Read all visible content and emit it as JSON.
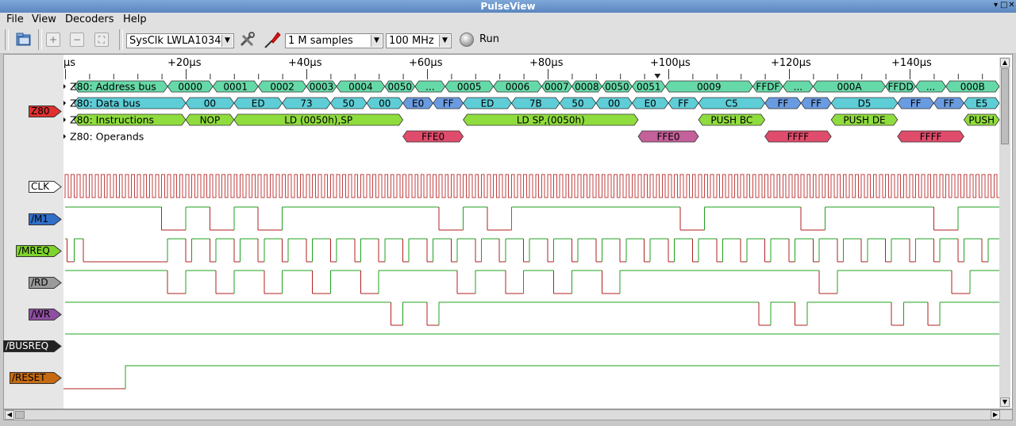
{
  "window": {
    "title": "PulseView"
  },
  "menu": [
    {
      "label": "File",
      "key": "F"
    },
    {
      "label": "View",
      "key": "V"
    },
    {
      "label": "Decoders",
      "key": "D"
    },
    {
      "label": "Help",
      "key": "H"
    }
  ],
  "toolbar": {
    "device": "SysClk LWLA1034",
    "samples": "1 M samples",
    "samplerate": "100 MHz",
    "run_label": "Run",
    "icons": [
      "open-icon",
      "zoom-in-icon",
      "zoom-out-icon",
      "zoom-fit-icon",
      "configure-device-icon",
      "probes-icon"
    ]
  },
  "ruler": {
    "labels": [
      "µs",
      "+20µs",
      "+40µs",
      "+60µs",
      "+80µs",
      "+100µs",
      "+120µs",
      "+140µs"
    ]
  },
  "decoder": {
    "name": "Z80",
    "color": "#e03030",
    "rows": [
      {
        "label": "Z80: Address bus",
        "color": "#66d9a8",
        "items": [
          {
            "t0": 1.5,
            "t1": 17,
            "text": ""
          },
          {
            "t0": 17,
            "t1": 24.5,
            "text": "0000"
          },
          {
            "t0": 24.5,
            "t1": 32,
            "text": "0001"
          },
          {
            "t0": 32,
            "t1": 40,
            "text": "0002"
          },
          {
            "t0": 40,
            "t1": 45,
            "text": "0003"
          },
          {
            "t0": 45,
            "t1": 53,
            "text": "0004"
          },
          {
            "t0": 53,
            "t1": 58,
            "text": "0050"
          },
          {
            "t0": 58,
            "t1": 63,
            "text": "..."
          },
          {
            "t0": 63,
            "t1": 71,
            "text": "0005"
          },
          {
            "t0": 71,
            "t1": 79,
            "text": "0006"
          },
          {
            "t0": 79,
            "t1": 84,
            "text": "0007"
          },
          {
            "t0": 84,
            "t1": 89,
            "text": "0008"
          },
          {
            "t0": 89,
            "t1": 94,
            "text": "0050"
          },
          {
            "t0": 94,
            "t1": 99.5,
            "text": "0051"
          },
          {
            "t0": 99.5,
            "t1": 114,
            "text": "0009"
          },
          {
            "t0": 114,
            "t1": 119,
            "text": "FFDF"
          },
          {
            "t0": 119,
            "t1": 124,
            "text": "..."
          },
          {
            "t0": 124,
            "t1": 136,
            "text": "000A"
          },
          {
            "t0": 136,
            "t1": 141,
            "text": "FFDD"
          },
          {
            "t0": 141,
            "t1": 146,
            "text": "..."
          },
          {
            "t0": 146,
            "t1": 157,
            "text": "000B"
          }
        ]
      },
      {
        "label": "Z80: Data bus",
        "color": "#5ecdd6",
        "items": [
          {
            "t0": 1.5,
            "t1": 20,
            "text": ""
          },
          {
            "t0": 20,
            "t1": 28,
            "text": "00",
            "c": "a"
          },
          {
            "t0": 28,
            "t1": 36,
            "text": "ED",
            "c": "a"
          },
          {
            "t0": 36,
            "t1": 44,
            "text": "73",
            "c": "a"
          },
          {
            "t0": 44,
            "t1": 50,
            "text": "50",
            "c": "a"
          },
          {
            "t0": 50,
            "t1": 56,
            "text": "00",
            "c": "a"
          },
          {
            "t0": 56,
            "t1": 61,
            "text": "E0",
            "c": "b"
          },
          {
            "t0": 61,
            "t1": 66,
            "text": "FF",
            "c": "b"
          },
          {
            "t0": 66,
            "t1": 74,
            "text": "ED",
            "c": "a"
          },
          {
            "t0": 74,
            "t1": 82,
            "text": "7B",
            "c": "a"
          },
          {
            "t0": 82,
            "t1": 88,
            "text": "50",
            "c": "a"
          },
          {
            "t0": 88,
            "t1": 94,
            "text": "00",
            "c": "a"
          },
          {
            "t0": 94,
            "t1": 100,
            "text": "E0",
            "c": "a"
          },
          {
            "t0": 100,
            "t1": 105,
            "text": "FF",
            "c": "a"
          },
          {
            "t0": 105,
            "t1": 116,
            "text": "C5",
            "c": "a"
          },
          {
            "t0": 116,
            "t1": 122,
            "text": "FF",
            "c": "b"
          },
          {
            "t0": 122,
            "t1": 127,
            "text": "FF",
            "c": "b"
          },
          {
            "t0": 127,
            "t1": 138,
            "text": "D5",
            "c": "a"
          },
          {
            "t0": 138,
            "t1": 144,
            "text": "FF",
            "c": "b"
          },
          {
            "t0": 144,
            "t1": 149,
            "text": "FF",
            "c": "b"
          },
          {
            "t0": 149,
            "t1": 157,
            "text": "E5",
            "c": "a"
          }
        ]
      },
      {
        "label": "Z80: Instructions",
        "color": "#8fdc3e",
        "items": [
          {
            "t0": 1.5,
            "t1": 20,
            "text": ""
          },
          {
            "t0": 20,
            "t1": 28,
            "text": "NOP"
          },
          {
            "t0": 28,
            "t1": 56,
            "text": "LD (0050h),SP"
          },
          {
            "t0": 66,
            "t1": 95,
            "text": "LD SP,(0050h)"
          },
          {
            "t0": 105,
            "t1": 116,
            "text": "PUSH BC"
          },
          {
            "t0": 127,
            "t1": 138,
            "text": "PUSH DE"
          },
          {
            "t0": 149,
            "t1": 157,
            "text": "PUSH"
          }
        ]
      },
      {
        "label": "Z80: Operands",
        "color": "#e04c6c",
        "items": [
          {
            "t0": 56,
            "t1": 66,
            "text": "FFE0"
          },
          {
            "t0": 95,
            "t1": 105,
            "text": "FFE0",
            "c": "p"
          },
          {
            "t0": 116,
            "t1": 127,
            "text": "FFFF"
          },
          {
            "t0": 138,
            "t1": 149,
            "text": "FFFF"
          }
        ]
      }
    ],
    "colors": {
      "a": "#5ecdd6",
      "b": "#6a9be0",
      "p": "#c4609a"
    }
  },
  "signals": [
    {
      "name": "CLK",
      "color": "#ffffff",
      "textcolor": "#000000",
      "kind": "clock"
    },
    {
      "name": "/M1",
      "color": "#2f6fc7",
      "textcolor": "#000000",
      "transitions": [
        16,
        20,
        24,
        28,
        32,
        36,
        62,
        66,
        70,
        74,
        102,
        106,
        122,
        126,
        144,
        148
      ]
    },
    {
      "name": "/MREQ",
      "color": "#7ed32c",
      "textcolor": "#000000",
      "transitions": [
        0.3,
        1.5,
        3,
        17,
        20,
        21,
        24,
        25,
        28,
        29,
        32,
        33,
        36,
        37,
        40,
        41,
        44,
        45,
        48,
        49,
        52,
        53,
        56,
        57,
        60,
        61,
        64,
        65,
        68,
        69,
        72,
        73,
        76,
        77,
        80,
        81,
        84,
        85,
        88,
        89,
        92,
        93,
        96,
        97,
        100,
        101,
        104,
        105,
        108,
        109,
        112,
        113,
        116,
        117,
        120,
        121,
        124,
        125,
        128,
        129,
        132,
        133,
        136,
        137,
        140,
        141,
        144,
        145,
        148,
        149,
        152,
        153,
        156
      ]
    },
    {
      "name": "/RD",
      "color": "#9a9a9a",
      "textcolor": "#000000",
      "transitions": [
        17,
        20,
        25,
        28,
        33,
        36,
        41,
        44,
        49,
        52,
        65,
        68,
        73,
        76,
        81,
        84,
        89,
        92,
        125,
        128,
        147,
        150
      ]
    },
    {
      "name": "/WR",
      "color": "#8e4fa0",
      "textcolor": "#000000",
      "transitions": [
        54,
        56,
        60,
        62,
        115,
        117,
        121,
        123,
        137,
        139,
        143,
        145
      ]
    },
    {
      "name": "/BUSREQ",
      "color": "#222222",
      "textcolor": "#ffffff",
      "transitions": []
    },
    {
      "name": "/RESET",
      "color": "#c56a10",
      "textcolor": "#000000",
      "low_until": 10
    }
  ]
}
